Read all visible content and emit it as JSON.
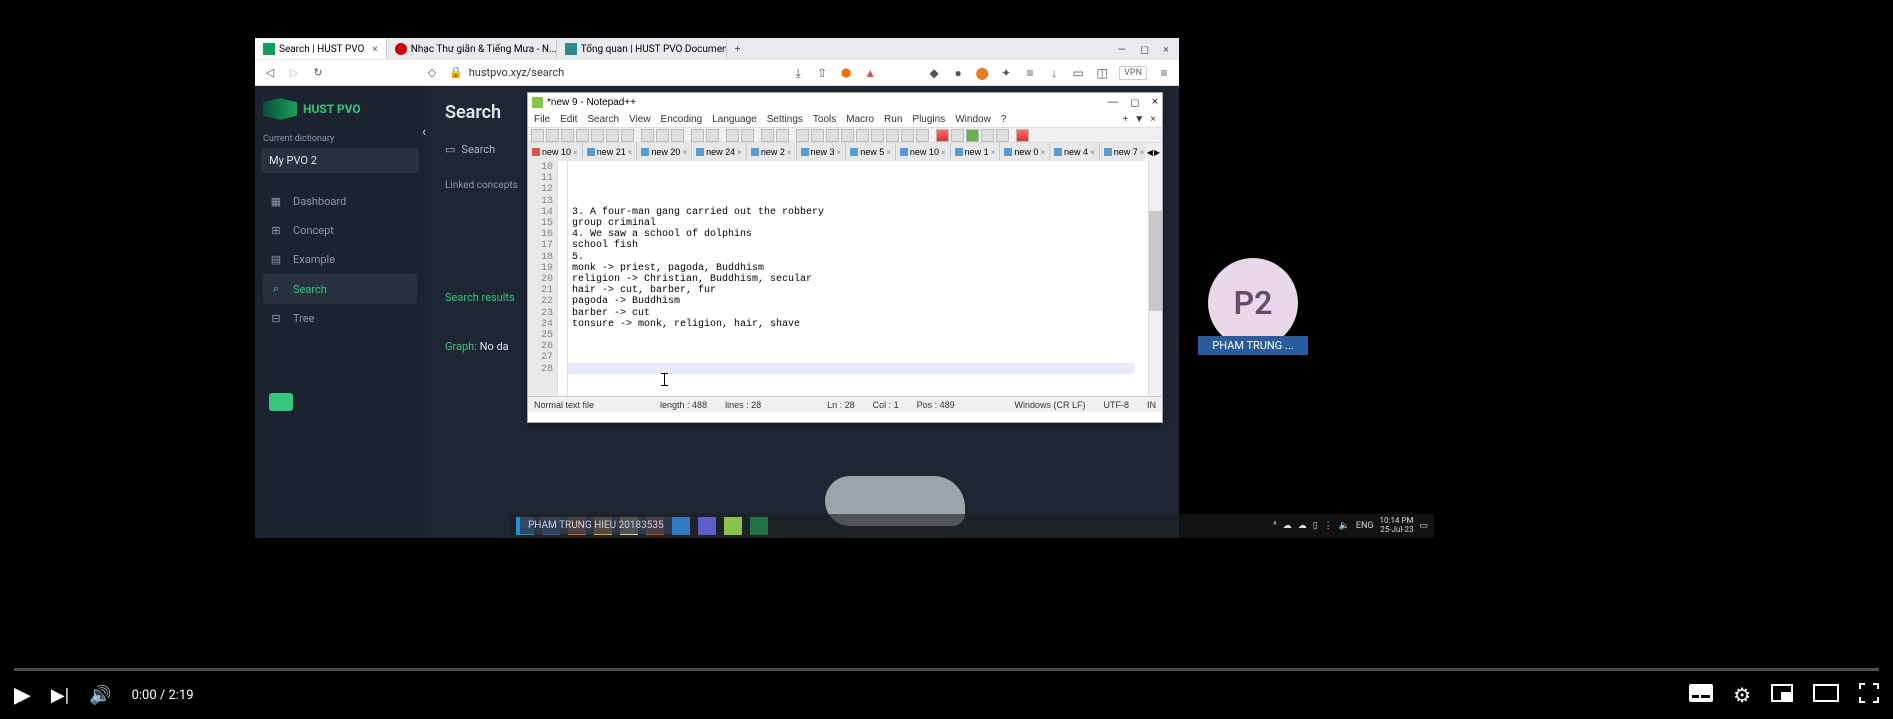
{
  "browser": {
    "tabs": [
      {
        "title": "Search | HUST PVO"
      },
      {
        "title": "Nhạc Thư giãn & Tiếng Mưa - N..."
      },
      {
        "title": "Tổng quan | HUST PVO Documentati..."
      }
    ],
    "url": "hustpvo.xyz/search",
    "vpn": "VPN"
  },
  "app": {
    "logo": "HUST PVO",
    "dict_label": "Current dictionary",
    "dict_name": "My PVO 2",
    "nav": {
      "dashboard": "Dashboard",
      "concept": "Concept",
      "example": "Example",
      "search": "Search",
      "tree": "Tree"
    },
    "main_title": "Search",
    "search_hint": "Search",
    "linked_concepts": "Linked concepts",
    "search_results": "Search results",
    "graph_label": "Graph:",
    "graph_value": "No da"
  },
  "npp": {
    "title": "*new 9 - Notepad++",
    "menu": [
      "File",
      "Edit",
      "Search",
      "View",
      "Encoding",
      "Language",
      "Settings",
      "Tools",
      "Macro",
      "Run",
      "Plugins",
      "Window",
      "?"
    ],
    "tabs": [
      "new 10",
      "new 21",
      "new 20",
      "new 24",
      "new 2",
      "new 3",
      "new 5",
      "new 10",
      "new 1",
      "new 0",
      "new 4",
      "new 7"
    ],
    "lines": [
      {
        "n": "10",
        "t": ""
      },
      {
        "n": "11",
        "t": "3. A four-man gang carried out the robbery"
      },
      {
        "n": "12",
        "t": ""
      },
      {
        "n": "13",
        "t": "group criminal"
      },
      {
        "n": "14",
        "t": ""
      },
      {
        "n": "15",
        "t": "4. We saw a school of dolphins"
      },
      {
        "n": "16",
        "t": ""
      },
      {
        "n": "17",
        "t": "school fish"
      },
      {
        "n": "18",
        "t": ""
      },
      {
        "n": "19",
        "t": "5."
      },
      {
        "n": "20",
        "t": "monk -> priest, pagoda, Buddhism"
      },
      {
        "n": "21",
        "t": "religion -> Christian, Buddhism, secular"
      },
      {
        "n": "22",
        "t": "hair -> cut, barber, fur"
      },
      {
        "n": "23",
        "t": "pagoda -> Buddhism"
      },
      {
        "n": "24",
        "t": "barber -> cut"
      },
      {
        "n": "25",
        "t": ""
      },
      {
        "n": "26",
        "t": "tonsure -> monk, religion, hair, shave"
      },
      {
        "n": "27",
        "t": ""
      },
      {
        "n": "28",
        "t": ""
      }
    ],
    "status": {
      "type": "Normal text file",
      "length": "length : 488",
      "lines": "lines : 28",
      "ln": "Ln : 28",
      "col": "Col : 1",
      "pos": "Pos : 489",
      "eol": "Windows (CR LF)",
      "enc": "UTF-8",
      "ins": "IN"
    }
  },
  "taskbar": {
    "lang": "ENG",
    "time": "10:14 PM",
    "date": "25-Jul-23"
  },
  "watermark": "PHAM TRUNG HIEU 20183535",
  "annotation": {
    "initials": "P2",
    "name": "PHAM TRUNG ..."
  },
  "player": {
    "current": "0:00",
    "sep": " / ",
    "duration": "2:19"
  }
}
